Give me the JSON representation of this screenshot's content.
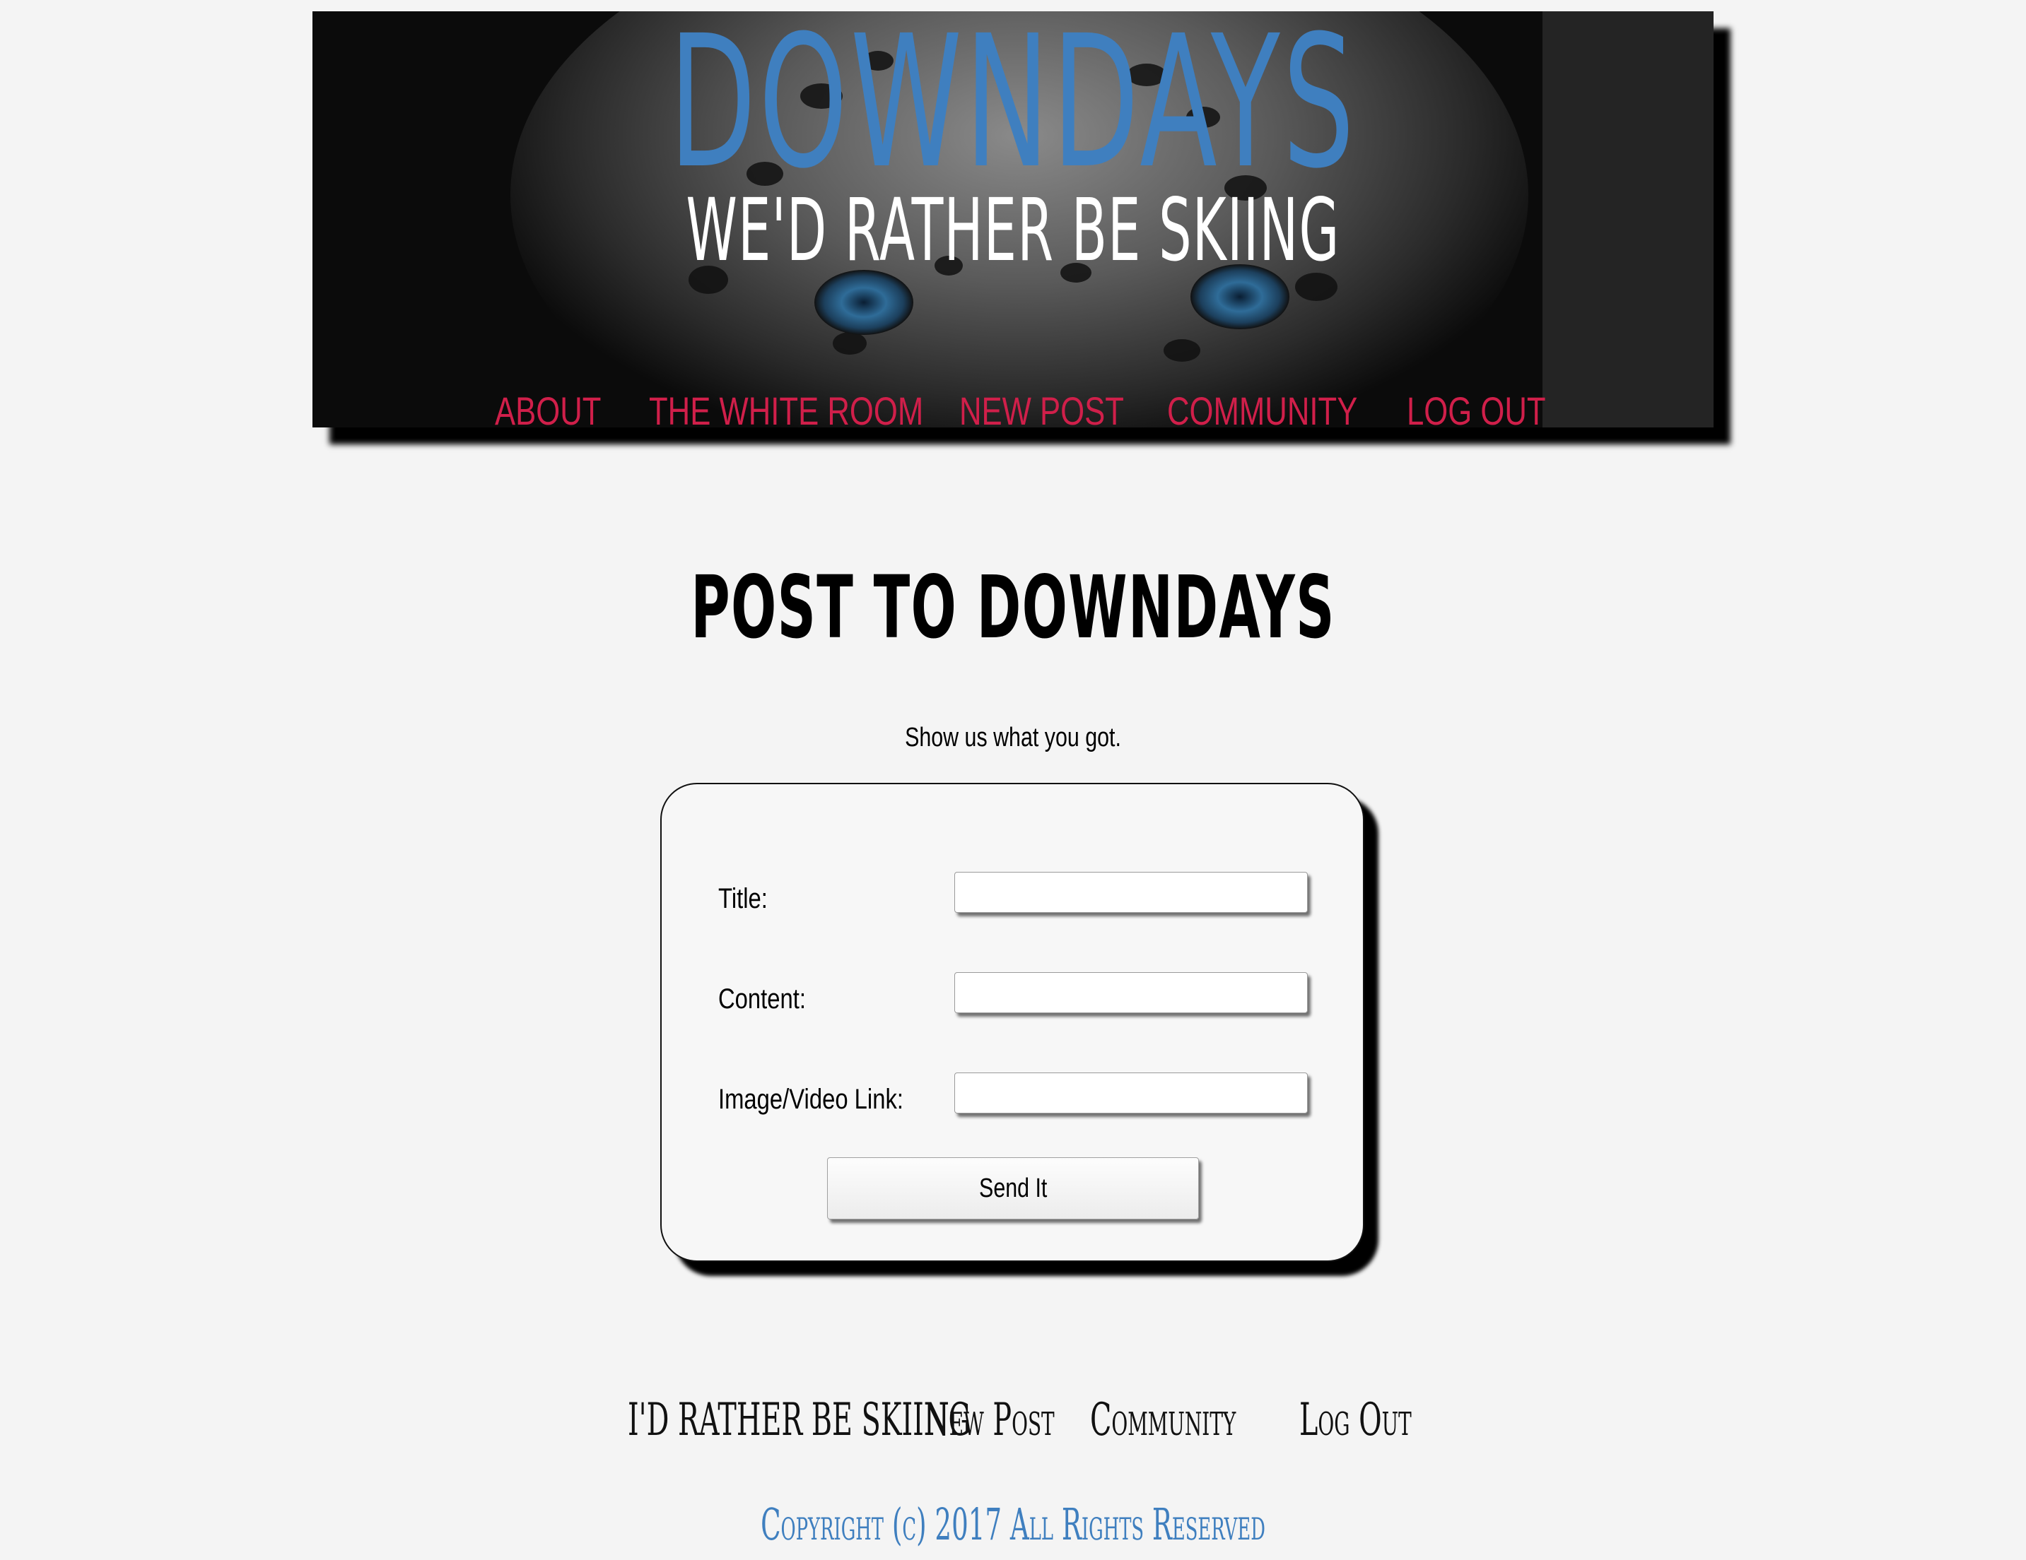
{
  "header": {
    "site_title": "DOWNDAYS",
    "tagline": "WE'D RATHER BE SKIING",
    "nav": [
      {
        "label": "ABOUT"
      },
      {
        "label": "THE WHITE ROOM"
      },
      {
        "label": "NEW POST"
      },
      {
        "label": "COMMUNITY"
      },
      {
        "label": "LOG OUT"
      }
    ]
  },
  "main": {
    "heading": "POST TO DOWNDAYS",
    "subheading": "Show us what you got.",
    "form": {
      "fields": [
        {
          "label": "Title:",
          "value": "",
          "placeholder": ""
        },
        {
          "label": "Content:",
          "value": "",
          "placeholder": ""
        },
        {
          "label": "Image/Video Link:",
          "value": "",
          "placeholder": ""
        }
      ],
      "submit_label": "Send It"
    }
  },
  "footer": {
    "nav": [
      {
        "label": "I'D RATHER BE SKIING"
      },
      {
        "label": "New Post"
      },
      {
        "label": "Community"
      },
      {
        "label": "Log Out"
      }
    ],
    "copyright": "Copyright (c) 2017 All Rights Reserved"
  },
  "colors": {
    "page_background": "#f4f4f4",
    "title_blue": "#3f7fbf",
    "nav_red": "#d01f4a",
    "banner_dark": "#0b0b0b"
  },
  "icons": {
    "banner_image": "snow-leopard-face-image"
  }
}
